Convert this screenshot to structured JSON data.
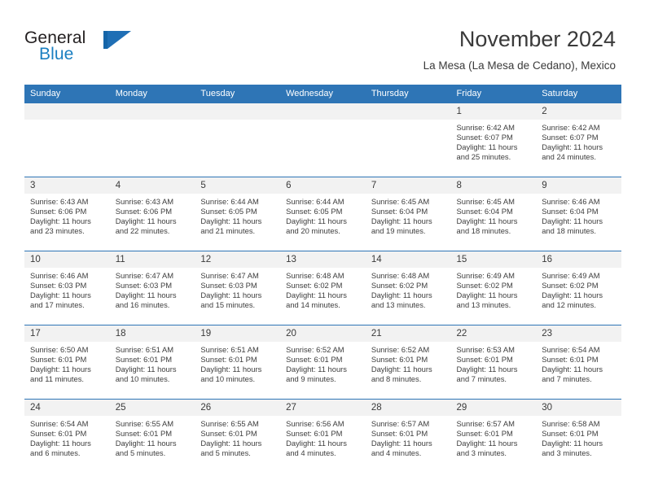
{
  "brand": {
    "line1": "General",
    "line2": "Blue",
    "mark": "blue-triangle-logo"
  },
  "header": {
    "title": "November 2024",
    "subtitle": "La Mesa (La Mesa de Cedano), Mexico"
  },
  "colors": {
    "header_blue": "#2e75b6",
    "daynum_gray": "#f2f2f2",
    "brand_blue": "#1a7fc1",
    "text": "#3a3a3a"
  },
  "calendar": {
    "weekday_headers": [
      "Sunday",
      "Monday",
      "Tuesday",
      "Wednesday",
      "Thursday",
      "Friday",
      "Saturday"
    ],
    "weeks": [
      [
        {
          "day": "",
          "sunrise": "",
          "sunset": "",
          "daylight": "",
          "daylight2": "",
          "empty": true
        },
        {
          "day": "",
          "sunrise": "",
          "sunset": "",
          "daylight": "",
          "daylight2": "",
          "empty": true
        },
        {
          "day": "",
          "sunrise": "",
          "sunset": "",
          "daylight": "",
          "daylight2": "",
          "empty": true
        },
        {
          "day": "",
          "sunrise": "",
          "sunset": "",
          "daylight": "",
          "daylight2": "",
          "empty": true
        },
        {
          "day": "",
          "sunrise": "",
          "sunset": "",
          "daylight": "",
          "daylight2": "",
          "empty": true
        },
        {
          "day": "1",
          "sunrise": "Sunrise: 6:42 AM",
          "sunset": "Sunset: 6:07 PM",
          "daylight": "Daylight: 11 hours",
          "daylight2": "and 25 minutes."
        },
        {
          "day": "2",
          "sunrise": "Sunrise: 6:42 AM",
          "sunset": "Sunset: 6:07 PM",
          "daylight": "Daylight: 11 hours",
          "daylight2": "and 24 minutes."
        }
      ],
      [
        {
          "day": "3",
          "sunrise": "Sunrise: 6:43 AM",
          "sunset": "Sunset: 6:06 PM",
          "daylight": "Daylight: 11 hours",
          "daylight2": "and 23 minutes."
        },
        {
          "day": "4",
          "sunrise": "Sunrise: 6:43 AM",
          "sunset": "Sunset: 6:06 PM",
          "daylight": "Daylight: 11 hours",
          "daylight2": "and 22 minutes."
        },
        {
          "day": "5",
          "sunrise": "Sunrise: 6:44 AM",
          "sunset": "Sunset: 6:05 PM",
          "daylight": "Daylight: 11 hours",
          "daylight2": "and 21 minutes."
        },
        {
          "day": "6",
          "sunrise": "Sunrise: 6:44 AM",
          "sunset": "Sunset: 6:05 PM",
          "daylight": "Daylight: 11 hours",
          "daylight2": "and 20 minutes."
        },
        {
          "day": "7",
          "sunrise": "Sunrise: 6:45 AM",
          "sunset": "Sunset: 6:04 PM",
          "daylight": "Daylight: 11 hours",
          "daylight2": "and 19 minutes."
        },
        {
          "day": "8",
          "sunrise": "Sunrise: 6:45 AM",
          "sunset": "Sunset: 6:04 PM",
          "daylight": "Daylight: 11 hours",
          "daylight2": "and 18 minutes."
        },
        {
          "day": "9",
          "sunrise": "Sunrise: 6:46 AM",
          "sunset": "Sunset: 6:04 PM",
          "daylight": "Daylight: 11 hours",
          "daylight2": "and 18 minutes."
        }
      ],
      [
        {
          "day": "10",
          "sunrise": "Sunrise: 6:46 AM",
          "sunset": "Sunset: 6:03 PM",
          "daylight": "Daylight: 11 hours",
          "daylight2": "and 17 minutes."
        },
        {
          "day": "11",
          "sunrise": "Sunrise: 6:47 AM",
          "sunset": "Sunset: 6:03 PM",
          "daylight": "Daylight: 11 hours",
          "daylight2": "and 16 minutes."
        },
        {
          "day": "12",
          "sunrise": "Sunrise: 6:47 AM",
          "sunset": "Sunset: 6:03 PM",
          "daylight": "Daylight: 11 hours",
          "daylight2": "and 15 minutes."
        },
        {
          "day": "13",
          "sunrise": "Sunrise: 6:48 AM",
          "sunset": "Sunset: 6:02 PM",
          "daylight": "Daylight: 11 hours",
          "daylight2": "and 14 minutes."
        },
        {
          "day": "14",
          "sunrise": "Sunrise: 6:48 AM",
          "sunset": "Sunset: 6:02 PM",
          "daylight": "Daylight: 11 hours",
          "daylight2": "and 13 minutes."
        },
        {
          "day": "15",
          "sunrise": "Sunrise: 6:49 AM",
          "sunset": "Sunset: 6:02 PM",
          "daylight": "Daylight: 11 hours",
          "daylight2": "and 13 minutes."
        },
        {
          "day": "16",
          "sunrise": "Sunrise: 6:49 AM",
          "sunset": "Sunset: 6:02 PM",
          "daylight": "Daylight: 11 hours",
          "daylight2": "and 12 minutes."
        }
      ],
      [
        {
          "day": "17",
          "sunrise": "Sunrise: 6:50 AM",
          "sunset": "Sunset: 6:01 PM",
          "daylight": "Daylight: 11 hours",
          "daylight2": "and 11 minutes."
        },
        {
          "day": "18",
          "sunrise": "Sunrise: 6:51 AM",
          "sunset": "Sunset: 6:01 PM",
          "daylight": "Daylight: 11 hours",
          "daylight2": "and 10 minutes."
        },
        {
          "day": "19",
          "sunrise": "Sunrise: 6:51 AM",
          "sunset": "Sunset: 6:01 PM",
          "daylight": "Daylight: 11 hours",
          "daylight2": "and 10 minutes."
        },
        {
          "day": "20",
          "sunrise": "Sunrise: 6:52 AM",
          "sunset": "Sunset: 6:01 PM",
          "daylight": "Daylight: 11 hours",
          "daylight2": "and 9 minutes."
        },
        {
          "day": "21",
          "sunrise": "Sunrise: 6:52 AM",
          "sunset": "Sunset: 6:01 PM",
          "daylight": "Daylight: 11 hours",
          "daylight2": "and 8 minutes."
        },
        {
          "day": "22",
          "sunrise": "Sunrise: 6:53 AM",
          "sunset": "Sunset: 6:01 PM",
          "daylight": "Daylight: 11 hours",
          "daylight2": "and 7 minutes."
        },
        {
          "day": "23",
          "sunrise": "Sunrise: 6:54 AM",
          "sunset": "Sunset: 6:01 PM",
          "daylight": "Daylight: 11 hours",
          "daylight2": "and 7 minutes."
        }
      ],
      [
        {
          "day": "24",
          "sunrise": "Sunrise: 6:54 AM",
          "sunset": "Sunset: 6:01 PM",
          "daylight": "Daylight: 11 hours",
          "daylight2": "and 6 minutes."
        },
        {
          "day": "25",
          "sunrise": "Sunrise: 6:55 AM",
          "sunset": "Sunset: 6:01 PM",
          "daylight": "Daylight: 11 hours",
          "daylight2": "and 5 minutes."
        },
        {
          "day": "26",
          "sunrise": "Sunrise: 6:55 AM",
          "sunset": "Sunset: 6:01 PM",
          "daylight": "Daylight: 11 hours",
          "daylight2": "and 5 minutes."
        },
        {
          "day": "27",
          "sunrise": "Sunrise: 6:56 AM",
          "sunset": "Sunset: 6:01 PM",
          "daylight": "Daylight: 11 hours",
          "daylight2": "and 4 minutes."
        },
        {
          "day": "28",
          "sunrise": "Sunrise: 6:57 AM",
          "sunset": "Sunset: 6:01 PM",
          "daylight": "Daylight: 11 hours",
          "daylight2": "and 4 minutes."
        },
        {
          "day": "29",
          "sunrise": "Sunrise: 6:57 AM",
          "sunset": "Sunset: 6:01 PM",
          "daylight": "Daylight: 11 hours",
          "daylight2": "and 3 minutes."
        },
        {
          "day": "30",
          "sunrise": "Sunrise: 6:58 AM",
          "sunset": "Sunset: 6:01 PM",
          "daylight": "Daylight: 11 hours",
          "daylight2": "and 3 minutes."
        }
      ]
    ]
  }
}
